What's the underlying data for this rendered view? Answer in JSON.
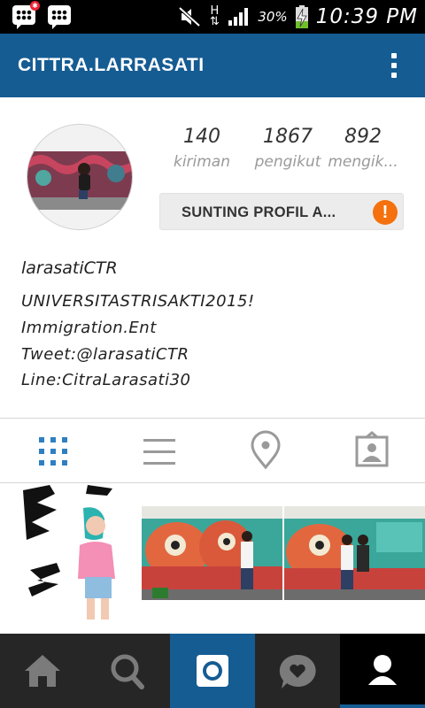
{
  "status_bar": {
    "battery_percent": "30%",
    "time": "10:39 PM",
    "network": "H",
    "colors": {
      "background": "#000000",
      "battery_charge": "#6fbf2b"
    }
  },
  "app_bar": {
    "username": "CITTRA.LARRASATI",
    "menu_icon": "overflow-menu-icon",
    "color": "#155c93"
  },
  "profile": {
    "stats": [
      {
        "value": "140",
        "label": "kiriman"
      },
      {
        "value": "1867",
        "label": "pengikut"
      },
      {
        "value": "892",
        "label": "mengik..."
      }
    ],
    "edit_button": {
      "label": "SUNTING PROFIL A...",
      "warning_icon": "!"
    },
    "accent_warning_color": "#f5710e"
  },
  "bio": {
    "name": "larasatiCTR",
    "lines": [
      "UNIVERSITASTRISAKTI2015!",
      "Immigration.Ent",
      "Tweet:@larasatiCTR",
      "Line:CitraLarasati30"
    ]
  },
  "view_tabs": [
    {
      "icon": "grid-icon",
      "active": true
    },
    {
      "icon": "list-icon",
      "active": false
    },
    {
      "icon": "location-pin-icon",
      "active": false
    },
    {
      "icon": "tagged-photos-icon",
      "active": false
    }
  ],
  "bottom_nav": [
    {
      "icon": "home-icon"
    },
    {
      "icon": "search-icon"
    },
    {
      "icon": "camera-icon",
      "active_color": "#155c93"
    },
    {
      "icon": "activity-heart-icon"
    },
    {
      "icon": "profile-icon",
      "active": true
    }
  ]
}
